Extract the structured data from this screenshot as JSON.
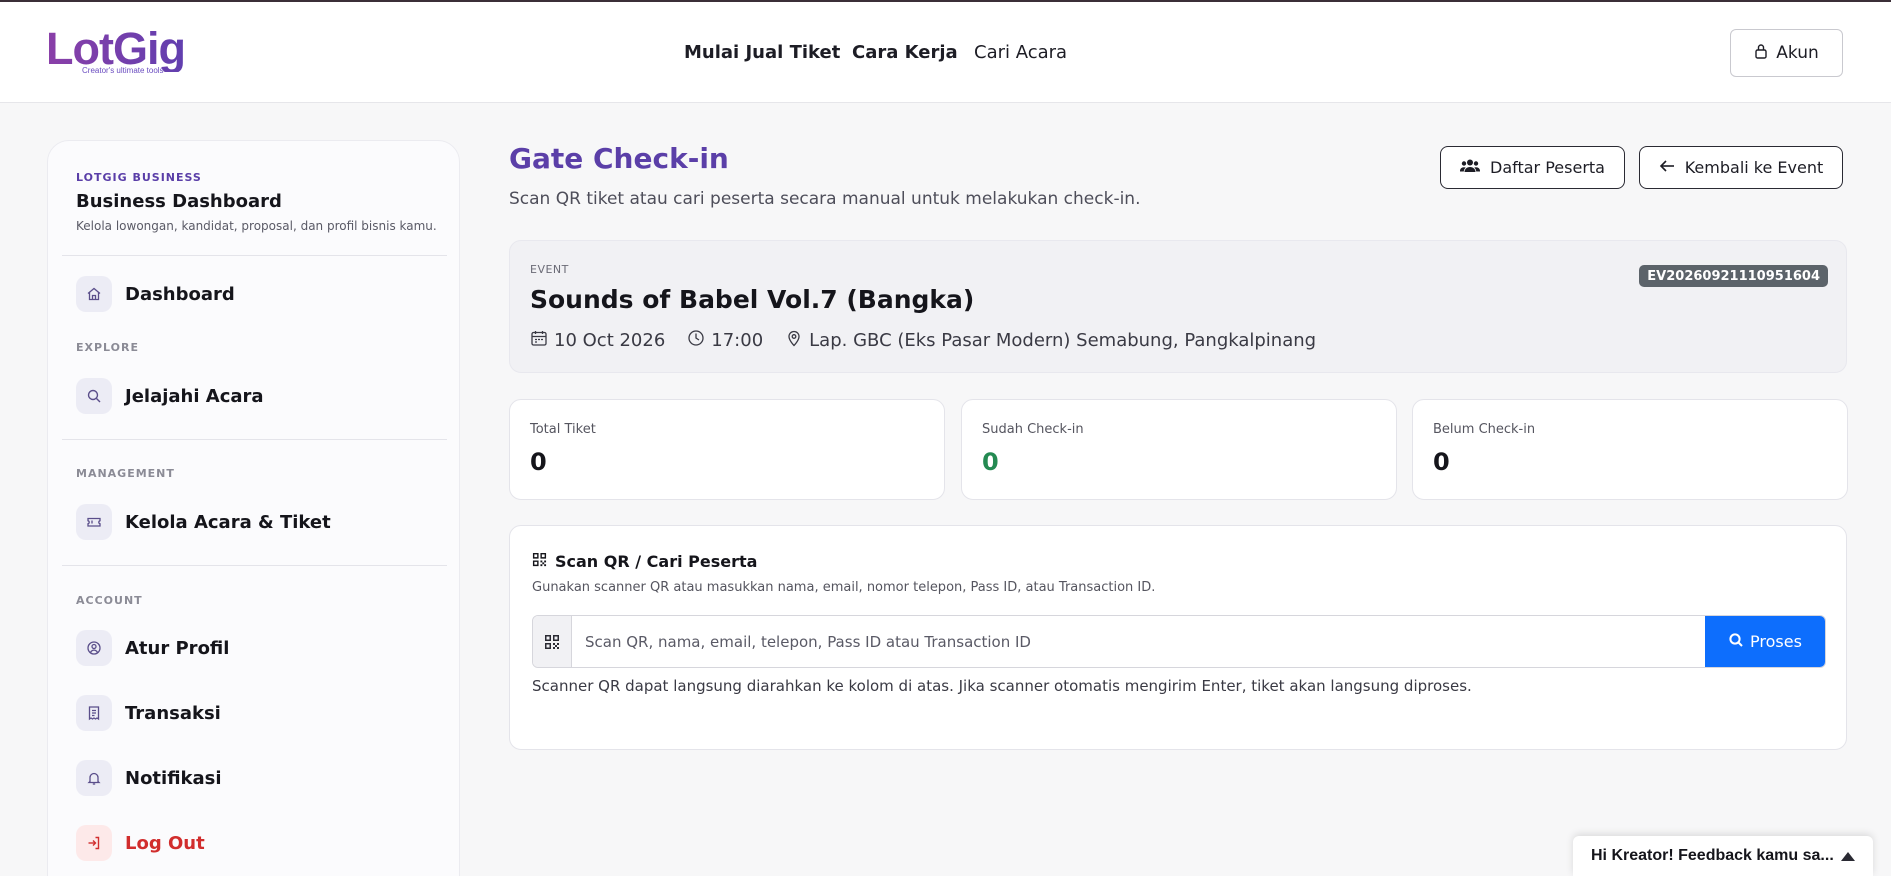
{
  "brand": {
    "name": "LotGig",
    "tagline": "Creator's ultimate tools"
  },
  "nav": {
    "items": [
      "Mulai Jual Tiket",
      "Cara Kerja",
      "Cari Acara"
    ],
    "account_label": "Akun"
  },
  "sidebar": {
    "kicker": "LOTGIG BUSINESS",
    "title": "Business Dashboard",
    "description": "Kelola lowongan, kandidat, proposal, dan profil bisnis kamu.",
    "dashboard": "Dashboard",
    "explore_label": "EXPLORE",
    "explore": "Jelajahi Acara",
    "management_label": "MANAGEMENT",
    "management": "Kelola Acara & Tiket",
    "account_label": "ACCOUNT",
    "account_items": [
      "Atur Profil",
      "Transaksi",
      "Notifikasi"
    ],
    "logout": "Log Out"
  },
  "page": {
    "title": "Gate Check-in",
    "subtitle": "Scan QR tiket atau cari peserta secara manual untuk melakukan check-in.",
    "btn_participants": "Daftar Peserta",
    "btn_back": "Kembali ke Event"
  },
  "event": {
    "kicker": "EVENT",
    "name": "Sounds of Babel Vol.7 (Bangka)",
    "date": "10 Oct 2026",
    "time": "17:00",
    "location": "Lap. GBC (Eks Pasar Modern) Semabung, Pangkalpinang",
    "code": "EV20260921110951604"
  },
  "stats": [
    {
      "label": "Total Tiket",
      "value": "0"
    },
    {
      "label": "Sudah Check-in",
      "value": "0"
    },
    {
      "label": "Belum Check-in",
      "value": "0"
    }
  ],
  "scan": {
    "title": "Scan QR / Cari Peserta",
    "description": "Gunakan scanner QR atau masukkan nama, email, nomor telepon, Pass ID, atau Transaction ID.",
    "value": "",
    "placeholder": "Scan QR, nama, email, telepon, Pass ID atau Transaction ID",
    "button": "Proses",
    "hint": "Scanner QR dapat langsung diarahkan ke kolom di atas. Jika scanner otomatis mengirim Enter, tiket akan langsung diproses."
  },
  "feedback": {
    "label": "Hi Kreator! Feedback kamu sa..."
  },
  "colors": {
    "accent": "#5b3fa8",
    "primary": "#0d6efd",
    "success": "#248a52",
    "danger": "#d12d2d"
  }
}
